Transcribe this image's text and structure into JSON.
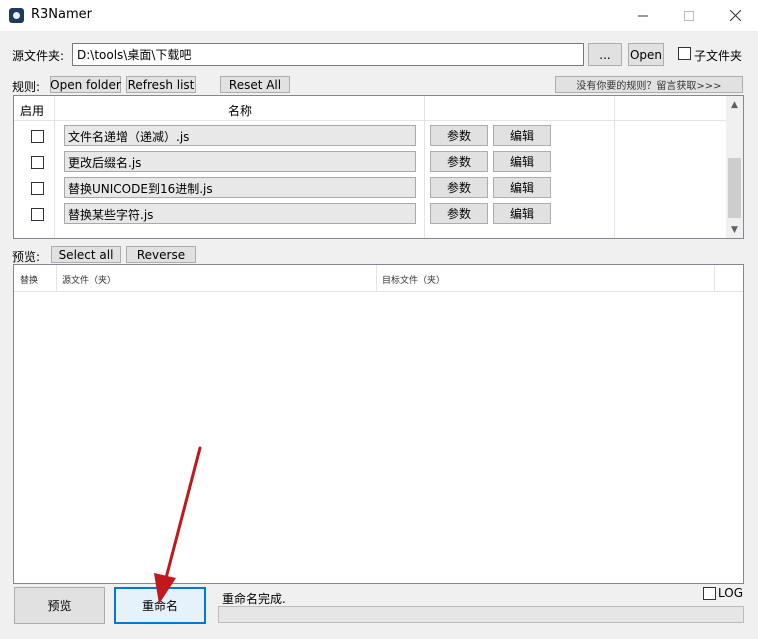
{
  "window": {
    "title": "R3Namer"
  },
  "source": {
    "label": "源文件夹:",
    "path": "D:\\tools\\桌面\\下载吧",
    "browse_label": "...",
    "open_label": "Open",
    "subfolder_label": "子文件夹"
  },
  "rules": {
    "label": "规则:",
    "open_folder_label": "Open folder",
    "refresh_label": "Refresh list",
    "reset_label": "Reset All",
    "get_more_label": "没有你要的规则？留言获取>>>",
    "columns": {
      "enable": "启用",
      "name": "名称"
    },
    "items": [
      {
        "name": "文件名递增（递减）.js",
        "params": "参数",
        "edit": "编辑"
      },
      {
        "name": "更改后缀名.js",
        "params": "参数",
        "edit": "编辑"
      },
      {
        "name": "替换UNICODE到16进制.js",
        "params": "参数",
        "edit": "编辑"
      },
      {
        "name": "替换某些字符.js",
        "params": "参数",
        "edit": "编辑"
      }
    ]
  },
  "preview": {
    "label": "预览:",
    "select_all_label": "Select all",
    "reverse_label": "Reverse",
    "columns": {
      "replace": "替换",
      "source": "源文件（夹）",
      "target": "目标文件（夹）"
    }
  },
  "bottom": {
    "preview_button": "预览",
    "rename_button": "重命名",
    "status": "重命名完成.",
    "log_label": "LOG"
  }
}
